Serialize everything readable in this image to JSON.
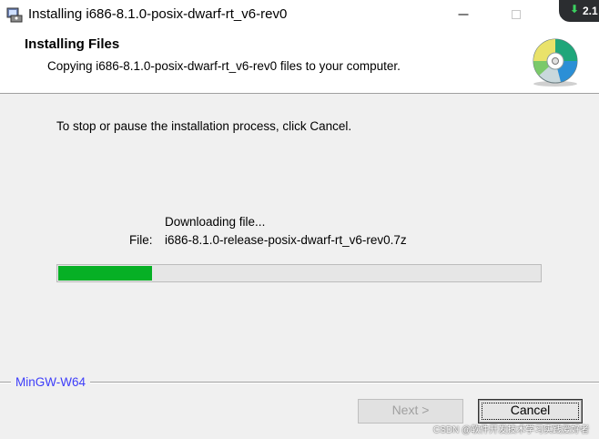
{
  "window": {
    "title": "Installing i686-8.1.0-posix-dwarf-rt_v6-rev0",
    "badge": "2.1"
  },
  "header": {
    "title": "Installing Files",
    "subtitle": "Copying i686-8.1.0-posix-dwarf-rt_v6-rev0 files to your computer."
  },
  "body": {
    "instruction": "To stop or pause the installation process, click Cancel.",
    "status": "Downloading file...",
    "file_label": "File:",
    "file_name": "i686-8.1.0-release-posix-dwarf-rt_v6-rev0.7z",
    "progress_percent": 19.5
  },
  "footer": {
    "brand": "MinGW-W64",
    "next_label": "Next >",
    "cancel_label": "Cancel"
  },
  "watermark": "CSDN @软件开发技术学习实践爱好者",
  "colors": {
    "progress": "#06b025",
    "brand": "#3d3dfa"
  },
  "icons": {
    "app": "installer-icon",
    "header": "cd-disc-icon"
  }
}
